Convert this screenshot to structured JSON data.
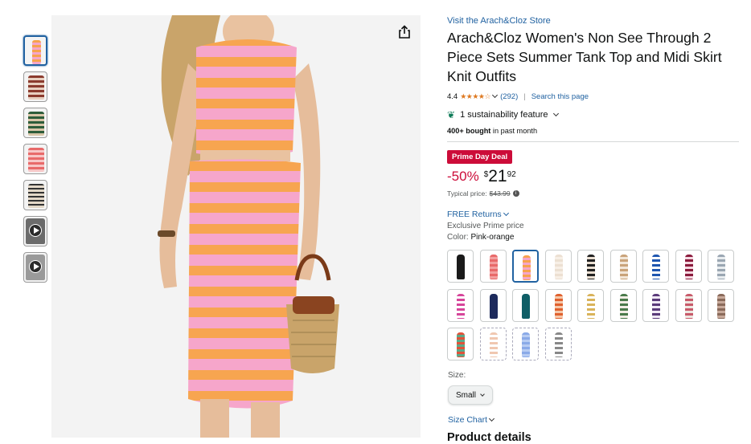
{
  "colors": {
    "link": "#2162a1",
    "deal_red": "#cc0c39",
    "star": "#de7921",
    "selected_border": "#2162a1"
  },
  "thumbnails": [
    {
      "kind": "image",
      "selected": true
    },
    {
      "kind": "image",
      "selected": false
    },
    {
      "kind": "image",
      "selected": false
    },
    {
      "kind": "image",
      "selected": false
    },
    {
      "kind": "image",
      "selected": false
    },
    {
      "kind": "video",
      "selected": false
    },
    {
      "kind": "video",
      "selected": false
    }
  ],
  "product": {
    "store_link": "Visit the Arach&Cloz Store",
    "title": "Arach&Cloz Women's Non See Through 2 Piece Sets Summer Tank Top and Midi Skirt Knit Outfits",
    "rating": "4.4",
    "rating_count": "(292)",
    "search_link": "Search this page",
    "sustainability": "1 sustainability feature",
    "bought_bold": "400+ bought",
    "bought_rest": " in past month",
    "deal_badge": "Prime Day Deal",
    "discount": "-50%",
    "price_symbol": "$",
    "price_whole": "21",
    "price_fraction": "92",
    "typical_label": "Typical price:",
    "typical_price": "$43.99",
    "returns": "FREE Returns",
    "exclusive": "Exclusive Prime price",
    "color_label": "Color:",
    "color_value": "Pink-orange"
  },
  "swatches": [
    {
      "c1": "#1a1a1a",
      "c2": "#1a1a1a",
      "state": "normal"
    },
    {
      "c1": "#e86a6a",
      "c2": "#f3a0a0",
      "state": "normal"
    },
    {
      "c1": "#f7a24d",
      "c2": "#f4a6c8",
      "state": "selected"
    },
    {
      "c1": "#ece0d2",
      "c2": "#f7efe6",
      "state": "normal"
    },
    {
      "c1": "#222222",
      "c2": "#eadfd2",
      "state": "normal"
    },
    {
      "c1": "#c9a37a",
      "c2": "#f2e6d8",
      "state": "normal"
    },
    {
      "c1": "#1e56b0",
      "c2": "#ffffff",
      "state": "normal"
    },
    {
      "c1": "#8a1a3c",
      "c2": "#f4d7e0",
      "state": "normal"
    },
    {
      "c1": "#9aa6b2",
      "c2": "#e8ecef",
      "state": "normal"
    },
    {
      "c1": "#d6459a",
      "c2": "#ffffff",
      "state": "normal"
    },
    {
      "c1": "#1d2a5c",
      "c2": "#1d2a5c",
      "state": "normal"
    },
    {
      "c1": "#0f5e66",
      "c2": "#0f5e66",
      "state": "normal"
    },
    {
      "c1": "#e0612e",
      "c2": "#f5c7a9",
      "state": "normal"
    },
    {
      "c1": "#d9b35a",
      "c2": "#ffffff",
      "state": "normal"
    },
    {
      "c1": "#4a7a4a",
      "c2": "#f1ede4",
      "state": "normal"
    },
    {
      "c1": "#5a3a7a",
      "c2": "#f0e8f5",
      "state": "normal"
    },
    {
      "c1": "#c85a6a",
      "c2": "#ede6e0",
      "state": "normal"
    },
    {
      "c1": "#8a6a5a",
      "c2": "#c7a99a",
      "state": "normal"
    },
    {
      "c1": "#e0533a",
      "c2": "#5aaa8a",
      "state": "normal"
    },
    {
      "c1": "#f0c7b0",
      "c2": "#ffffff",
      "state": "unavailable"
    },
    {
      "c1": "#8aaae8",
      "c2": "#b7ccf2",
      "state": "unavailable"
    },
    {
      "c1": "#888888",
      "c2": "#ffffff",
      "state": "unavailable"
    }
  ],
  "size": {
    "label": "Size:",
    "value": "Small"
  },
  "size_chart": "Size Chart",
  "product_details": "Product details"
}
